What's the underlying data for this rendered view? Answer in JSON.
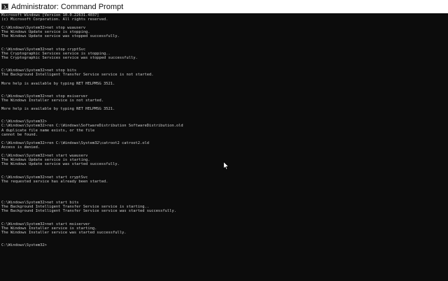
{
  "window": {
    "title": "Administrator: Command Prompt"
  },
  "console": {
    "lines": [
      "Microsoft Windows [Version 10.0.22631.4037]",
      "(c) Microsoft Corporation. All rights reserved.",
      "",
      "C:\\Windows\\System32>net stop wuauserv",
      "The Windows Update service is stopping.",
      "The Windows Update service was stopped successfully.",
      "",
      "",
      "C:\\Windows\\System32>net stop cryptSvc",
      "The Cryptographic Services service is stopping..",
      "The Cryptographic Services service was stopped successfully.",
      "",
      "",
      "C:\\Windows\\System32>net stop bits",
      "The Background Intelligent Transfer Service service is not started.",
      "",
      "More help is available by typing NET HELPMSG 3521.",
      "",
      "",
      "C:\\Windows\\System32>net stop msiserver",
      "The Windows Installer service is not started.",
      "",
      "More help is available by typing NET HELPMSG 3521.",
      "",
      "",
      "C:\\Windows\\System32>",
      "C:\\Windows\\System32>ren C:\\Windows\\SoftwareDistribution SoftwareDistribution.old",
      "A duplicate file name exists, or the file",
      "cannot be found.",
      "",
      "C:\\Windows\\System32>ren C:\\Windows\\System32\\catroot2 catroot2.old",
      "Access is denied.",
      "",
      "C:\\Windows\\System32>net start wuauserv",
      "The Windows Update service is starting.",
      "The Windows Update service was started successfully.",
      "",
      "",
      "C:\\Windows\\System32>net start cryptSvc",
      "The requested service has already been started.",
      "",
      "",
      "",
      "",
      "C:\\Windows\\System32>net start bits",
      "The Background Intelligent Transfer Service service is starting..",
      "The Background Intelligent Transfer Service service was started successfully.",
      "",
      "",
      "C:\\Windows\\System32>net start msiserver",
      "The Windows Installer service is starting.",
      "The Windows Installer service was started successfully.",
      "",
      "",
      "C:\\Windows\\System32>"
    ]
  },
  "colors": {
    "background": "#0c0c0c",
    "text": "#cccccc",
    "titlebar": "#ffffff"
  }
}
